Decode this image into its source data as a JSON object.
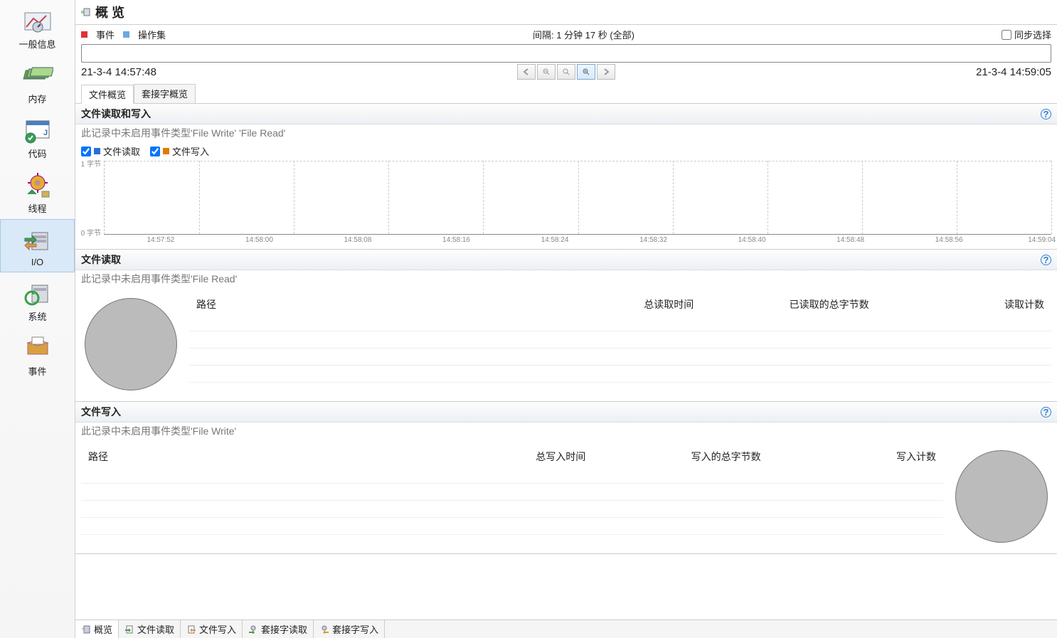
{
  "sidebar": {
    "items": [
      {
        "label": "一般信息",
        "name": "sidebar-item-general"
      },
      {
        "label": "内存",
        "name": "sidebar-item-memory"
      },
      {
        "label": "代码",
        "name": "sidebar-item-code"
      },
      {
        "label": "线程",
        "name": "sidebar-item-threads"
      },
      {
        "label": "I/O",
        "name": "sidebar-item-io"
      },
      {
        "label": "系统",
        "name": "sidebar-item-system"
      },
      {
        "label": "事件",
        "name": "sidebar-item-events"
      }
    ],
    "selected_index": 4
  },
  "page": {
    "title": "概 览"
  },
  "toolbar": {
    "legend_event": "事件",
    "legend_opset": "操作集",
    "interval_label": "间隔: 1 分钟 17 秒 (全部)",
    "sync_label": "同步选择",
    "start_time": "21-3-4 14:57:48",
    "end_time": "21-3-4 14:59:05"
  },
  "top_tabs": [
    {
      "label": "文件概览",
      "name": "tab-file-overview"
    },
    {
      "label": "套接字概览",
      "name": "tab-socket-overview"
    }
  ],
  "top_tabs_active": 0,
  "section_rw": {
    "title": "文件读取和写入",
    "sub": "此记录中未启用事件类型'File Write' 'File Read'",
    "legend_read": "文件读取",
    "legend_write": "文件写入"
  },
  "section_read": {
    "title": "文件读取",
    "sub": "此记录中未启用事件类型'File Read'",
    "columns": [
      "路径",
      "总读取时间",
      "已读取的总字节数",
      "读取计数"
    ]
  },
  "section_write": {
    "title": "文件写入",
    "sub": "此记录中未启用事件类型'File Write'",
    "columns": [
      "路径",
      "总写入时间",
      "写入的总字节数",
      "写入计数"
    ]
  },
  "bottom_tabs": [
    {
      "label": "概览",
      "name": "btab-overview"
    },
    {
      "label": "文件读取",
      "name": "btab-file-read"
    },
    {
      "label": "文件写入",
      "name": "btab-file-write"
    },
    {
      "label": "套接字读取",
      "name": "btab-socket-read"
    },
    {
      "label": "套接字写入",
      "name": "btab-socket-write"
    }
  ],
  "bottom_tabs_active": 0,
  "chart_data": {
    "type": "line",
    "title": "文件读取和写入",
    "xlabel": "",
    "ylabel": "字节",
    "ylim": [
      0,
      1
    ],
    "x_ticks": [
      "14:57:52",
      "14:58:00",
      "14:58:08",
      "14:58:16",
      "14:58:24",
      "14:58:32",
      "14:58:40",
      "14:58:48",
      "14:58:56",
      "14:59:04"
    ],
    "y_ticks": [
      {
        "value": 0,
        "label": "0 字节"
      },
      {
        "value": 1,
        "label": "1 字节"
      }
    ],
    "series": [
      {
        "name": "文件读取",
        "color": "#2a6fd6",
        "values": []
      },
      {
        "name": "文件写入",
        "color": "#e07a00",
        "values": []
      }
    ]
  },
  "colors": {
    "event": "#d33",
    "opset": "#6aa9e0",
    "read": "#2a6fd6",
    "write": "#e07a00"
  }
}
